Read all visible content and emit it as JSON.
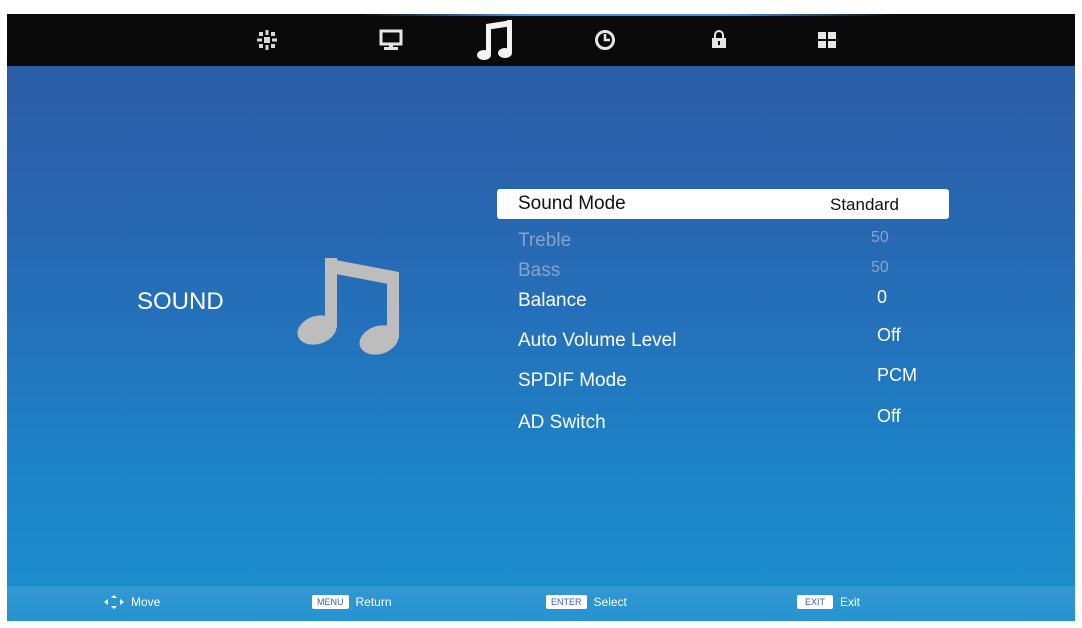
{
  "topbar": {
    "tabs": [
      {
        "icon": "picture-settings-icon",
        "active": false
      },
      {
        "icon": "monitor-icon",
        "active": false
      },
      {
        "icon": "music-note-icon",
        "active": true
      },
      {
        "icon": "clock-icon",
        "active": false
      },
      {
        "icon": "lock-icon",
        "active": false
      },
      {
        "icon": "grid-icon",
        "active": false
      }
    ]
  },
  "section": {
    "title": "SOUND",
    "icon": "music-note-icon"
  },
  "menu": {
    "items": [
      {
        "label": "Sound Mode",
        "value": "Standard",
        "state": "selected"
      },
      {
        "label": "Treble",
        "value": "50",
        "state": "disabled"
      },
      {
        "label": "Bass",
        "value": "50",
        "state": "disabled"
      },
      {
        "label": "Balance",
        "value": "0",
        "state": "normal"
      },
      {
        "label": "Auto Volume Level",
        "value": "Off",
        "state": "normal"
      },
      {
        "label": "SPDIF Mode",
        "value": "PCM",
        "state": "normal"
      },
      {
        "label": "AD Switch",
        "value": "Off",
        "state": "normal"
      }
    ]
  },
  "footer": {
    "move": {
      "icon": "navigation-arrows-icon",
      "text": "Move"
    },
    "return": {
      "key": "MENU",
      "text": "Return"
    },
    "select": {
      "key": "ENTER",
      "text": "Select"
    },
    "exit": {
      "key": "EXIT",
      "text": "Exit"
    }
  },
  "colors": {
    "background_top": "#2d5aa3",
    "background_bottom": "#1b8fcf",
    "topbar": "#0a0a0a",
    "disabled_text": "#8aa2c6",
    "highlight": "#ffffff"
  }
}
